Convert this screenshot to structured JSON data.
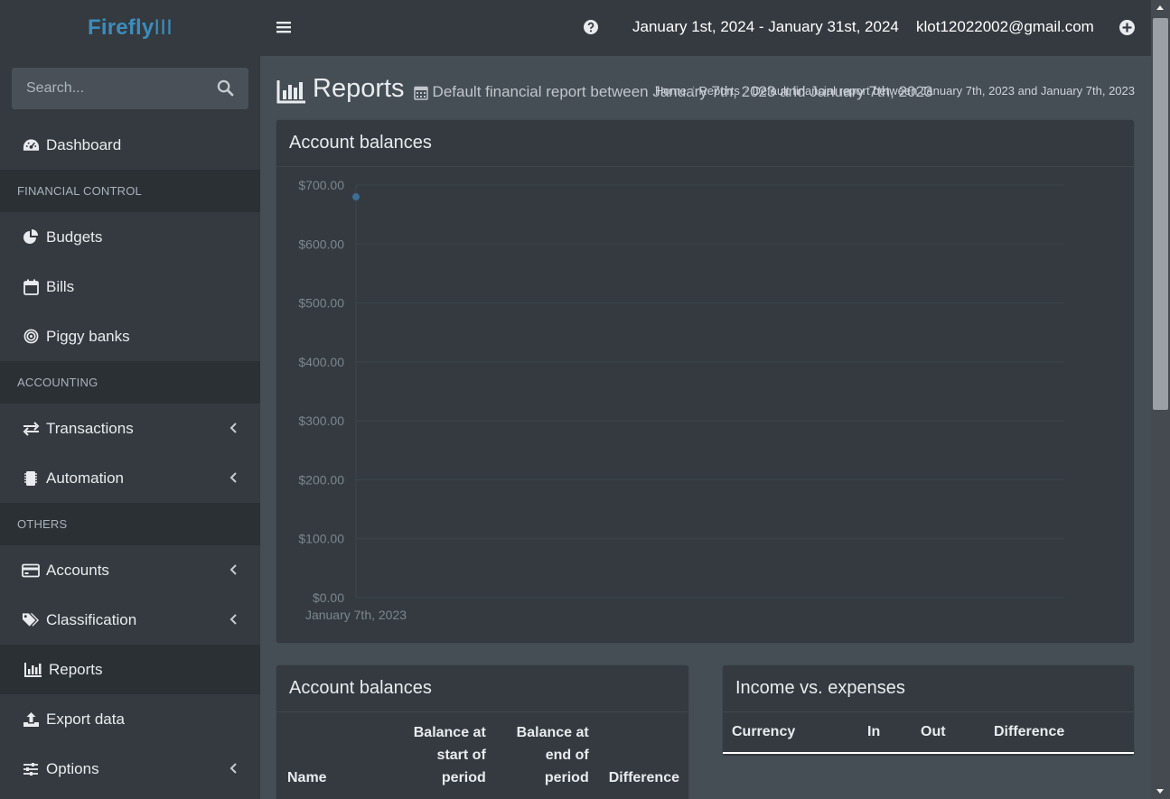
{
  "app": {
    "brand_main": "Firefly",
    "brand_suffix": "III"
  },
  "search": {
    "placeholder": "Search..."
  },
  "sidebar": {
    "dashboard": "Dashboard",
    "header_financial": "FINANCIAL CONTROL",
    "budgets": "Budgets",
    "bills": "Bills",
    "piggy_banks": "Piggy banks",
    "header_accounting": "ACCOUNTING",
    "transactions": "Transactions",
    "automation": "Automation",
    "header_others": "OTHERS",
    "accounts": "Accounts",
    "classification": "Classification",
    "reports": "Reports",
    "export_data": "Export data",
    "options": "Options"
  },
  "topbar": {
    "date_range": "January 1st, 2024 - January 31st, 2024",
    "user_email": "klot12022002@gmail.com"
  },
  "page": {
    "title": "Reports",
    "subtitle": "Default financial report between January 7th, 2023 and January 7th, 2023",
    "breadcrumb": [
      "Home",
      "Reports",
      "Default financial report between January 7th, 2023 and January 7th, 2023"
    ]
  },
  "chart_card": {
    "title": "Account balances"
  },
  "chart_data": {
    "type": "line",
    "title": "Account balances",
    "xlabel": "",
    "ylabel": "",
    "x": [
      "January 7th, 2023"
    ],
    "series": [
      {
        "values": [
          680
        ]
      }
    ],
    "ylim": [
      0,
      700
    ],
    "yticks": [
      "$0.00",
      "$100.00",
      "$200.00",
      "$300.00",
      "$400.00",
      "$500.00",
      "$600.00",
      "$700.00"
    ],
    "grid": true,
    "colors": {
      "point": "#3c6e96",
      "grid": "#3d444b",
      "tick": "#7d858d"
    }
  },
  "balances_card": {
    "title": "Account balances",
    "columns": [
      "Name",
      "Balance at start of period",
      "Balance at end of period",
      "Difference"
    ]
  },
  "income_card": {
    "title": "Income vs. expenses",
    "columns": [
      "Currency",
      "In",
      "Out",
      "Difference"
    ]
  }
}
